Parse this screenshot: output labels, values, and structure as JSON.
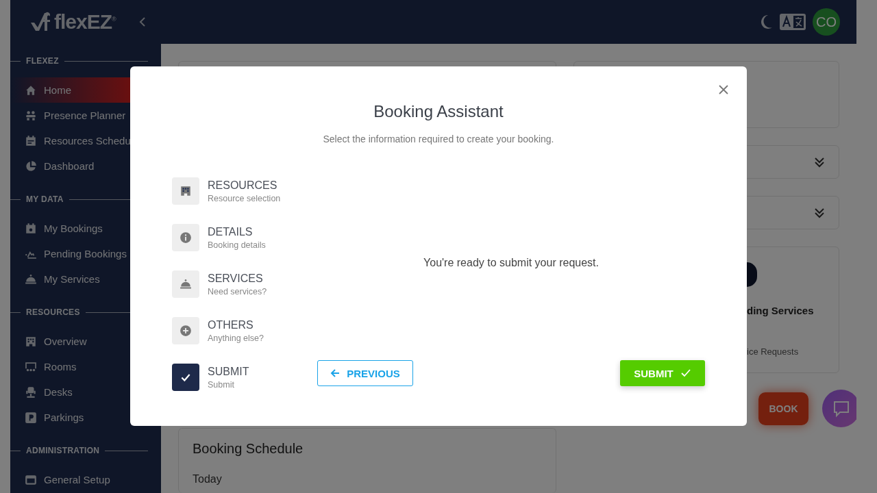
{
  "header": {
    "logo": "flexEZ$^{®}$",
    "avatar": "CO"
  },
  "sidebar": {
    "sections": [
      {
        "title": "FLEXEZ",
        "items": [
          {
            "label": "Home",
            "kind": "home",
            "selected": true
          },
          {
            "label": "Presence Planner",
            "kind": "people",
            "selected": false
          },
          {
            "label": "Resources Schedu",
            "kind": "calendar",
            "selected": false
          },
          {
            "label": "Dashboard",
            "kind": "pie",
            "selected": false
          }
        ]
      },
      {
        "title": "MY DATA",
        "items": [
          {
            "label": "My Bookings",
            "kind": "calendar-star",
            "selected": false
          },
          {
            "label": "Pending Bookings",
            "kind": "pending",
            "selected": false
          },
          {
            "label": "My Services",
            "kind": "bell",
            "selected": false
          }
        ]
      },
      {
        "title": "RESOURCES",
        "items": [
          {
            "label": "Overview",
            "kind": "building",
            "selected": false
          },
          {
            "label": "Rooms",
            "kind": "room",
            "selected": false
          },
          {
            "label": "Desks",
            "kind": "chair",
            "selected": false
          },
          {
            "label": "Parkings",
            "kind": "parking",
            "selected": false
          }
        ]
      },
      {
        "title": "ADMINISTRATION",
        "items": [
          {
            "label": "General Setup",
            "kind": "window",
            "selected": false
          }
        ]
      }
    ]
  },
  "dashboard": {
    "services_card": {
      "title": "ding Services",
      "subtitle": "ice Requests"
    },
    "schedule": {
      "title": "Booking Schedule",
      "day": "Today"
    },
    "book_button": "BOOK"
  },
  "modal": {
    "title": "Booking Assistant",
    "subtitle": "Select the information required to create your booking.",
    "steps": [
      {
        "title": "RESOURCES",
        "subtitle": "Resource selection",
        "kind": "building",
        "selected": false
      },
      {
        "title": "DETAILS",
        "subtitle": "Booking details",
        "kind": "info",
        "selected": false
      },
      {
        "title": "SERVICES",
        "subtitle": "Need services?",
        "kind": "bell",
        "selected": false
      },
      {
        "title": "OTHERS",
        "subtitle": "Anything else?",
        "kind": "plus",
        "selected": false
      },
      {
        "title": "SUBMIT",
        "subtitle": "Submit",
        "kind": "check",
        "selected": true
      }
    ],
    "message": "You're ready to submit your request.",
    "previous_button": "PREVIOUS",
    "submit_button": "SUBMIT"
  }
}
